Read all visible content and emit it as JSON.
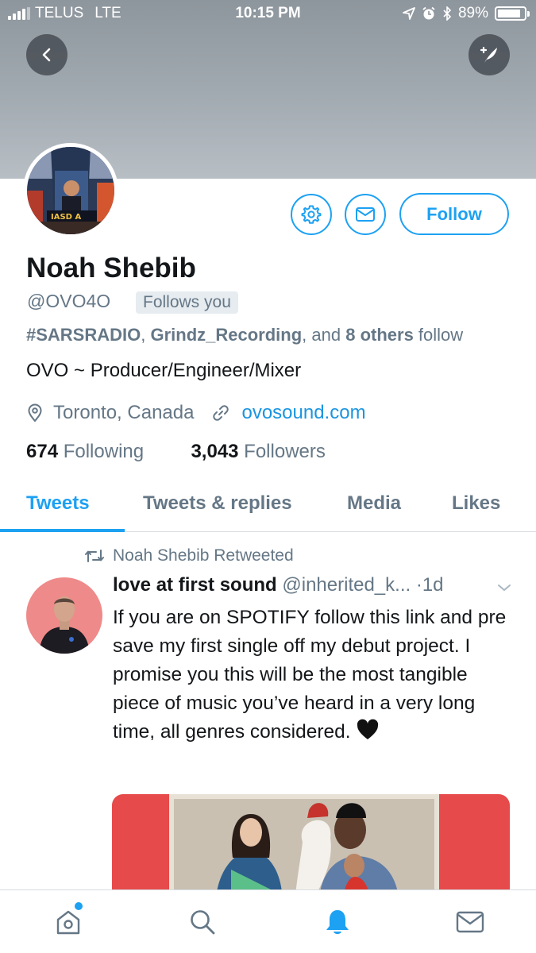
{
  "status_bar": {
    "carrier": "TELUS",
    "network": "LTE",
    "time": "10:15 PM",
    "battery": "89%",
    "battery_level": 0.89
  },
  "profile": {
    "name": "Noah Shebib",
    "handle": "@OVO4O",
    "follows_you": "Follows you",
    "followed_by_1": "#SARSRADIO",
    "followed_by_sep1": ", ",
    "followed_by_2": "Grindz_Recording",
    "followed_by_sep2": ", and ",
    "followed_by_others": "8 others",
    "followed_by_suffix": " follow",
    "bio": "OVO ~ Producer/Engineer/Mixer",
    "location": "Toronto, Canada",
    "website": "ovosound.com",
    "following_count": "674",
    "following_label": " Following",
    "followers_count": "3,043",
    "followers_label": " Followers",
    "follow_button": "Follow"
  },
  "tabs": [
    {
      "label": "Tweets",
      "active": true
    },
    {
      "label": "Tweets & replies",
      "active": false
    },
    {
      "label": "Media",
      "active": false
    },
    {
      "label": "Likes",
      "active": false
    }
  ],
  "tweet": {
    "retweeted_by": "Noah Shebib Retweeted",
    "author": "love at first sound",
    "handle": "@inherited_k...",
    "time": "·1d",
    "text": "If you are on SPOTIFY follow this link and pre save my first single off my debut project.  I promise you this will be the most tangible piece of music you’ve heard in a very long time, all genres considered."
  },
  "colors": {
    "accent": "#1da1f2",
    "secondary_text": "#657786",
    "primary_text": "#14171a"
  },
  "icons": {
    "back": "back-arrow-icon",
    "compose": "compose-tweet-icon",
    "settings": "gear-icon",
    "message": "envelope-icon",
    "location": "location-pin-icon",
    "link": "link-icon",
    "retweet": "retweet-icon",
    "chevron": "chevron-down-icon",
    "heart": "black-heart-emoji",
    "nav_home": "home-icon",
    "nav_search": "search-icon",
    "nav_notifications": "bell-icon",
    "nav_messages": "envelope-icon"
  }
}
